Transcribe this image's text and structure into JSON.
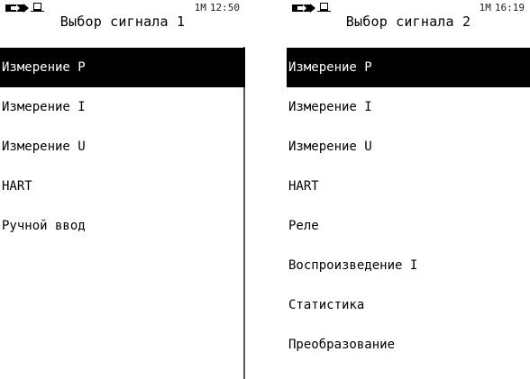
{
  "screens": [
    {
      "title": "Выбор сигнала 1",
      "status": {
        "channel": "1M",
        "time": "12:50"
      },
      "items": [
        "Измерение P",
        "Измерение I",
        "Измерение U",
        "HART",
        "Ручной ввод"
      ],
      "selected_index": 0
    },
    {
      "title": "Выбор сигнала 2",
      "status": {
        "channel": "1M",
        "time": "16:19"
      },
      "items": [
        "Измерение P",
        "Измерение I",
        "Измерение U",
        "HART",
        "Реле",
        "Воспроизведение I",
        "Статистика",
        "Преобразование"
      ],
      "selected_index": 0
    }
  ],
  "icons": {
    "battery": "battery-icon",
    "usb": "usb-icon"
  },
  "colors": {
    "selection_bg": "#000000",
    "selection_fg": "#ffffff",
    "background": "#ffffff"
  }
}
